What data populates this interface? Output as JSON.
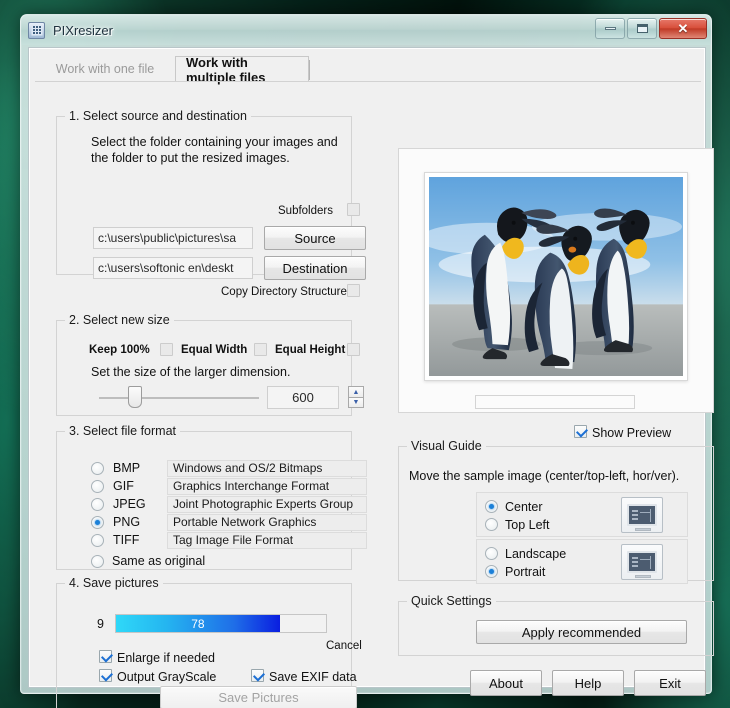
{
  "window": {
    "title": "PIXresizer",
    "icon": "app-grid-icon",
    "controls": {
      "minimize": "Minimize",
      "maximize": "Maximize",
      "close": "Close",
      "close_glyph": "✕"
    }
  },
  "tabs": [
    {
      "label": "Work with one file",
      "active": false
    },
    {
      "label": "Work with multiple files",
      "active": true
    }
  ],
  "section1": {
    "legend": "1. Select source and destination",
    "help_line1": "Select the folder containing your images and",
    "help_line2": "the folder to put the resized images.",
    "subfolders_label": "Subfolders",
    "subfolders_checked": false,
    "source_value": "c:\\users\\public\\pictures\\sa",
    "source_button": "Source",
    "destination_value": "c:\\users\\softonic en\\deskt",
    "destination_button": "Destination",
    "copy_dir_label": "Copy Directory Structure",
    "copy_dir_checked": false
  },
  "section2": {
    "legend": "2. Select new size",
    "keep_label": "Keep 100%",
    "keep_checked": false,
    "equal_width_label": "Equal Width",
    "equal_width_checked": false,
    "equal_height_label": "Equal Height",
    "equal_height_checked": false,
    "instruction": "Set the size of the larger dimension.",
    "size_value": "600",
    "slider_percent": 19,
    "spin_up": "▲",
    "spin_down": "▼"
  },
  "section3": {
    "legend": "3. Select file format",
    "formats": [
      {
        "name": "BMP",
        "desc": "Windows and OS/2 Bitmaps",
        "selected": false
      },
      {
        "name": "GIF",
        "desc": "Graphics Interchange Format",
        "selected": false
      },
      {
        "name": "JPEG",
        "desc": "Joint Photographic Experts Group",
        "selected": false
      },
      {
        "name": "PNG",
        "desc": "Portable Network Graphics",
        "selected": true
      },
      {
        "name": "TIFF",
        "desc": "Tag Image File Format",
        "selected": false
      }
    ],
    "same_as_original": "Same as original",
    "same_as_original_selected": false
  },
  "section4": {
    "legend": "4. Save pictures",
    "counter": "9",
    "progress_value": "78",
    "progress_percent": 78,
    "cancel_label": "Cancel",
    "enlarge_label": "Enlarge if needed",
    "enlarge_checked": true,
    "grayscale_label": "Output GrayScale",
    "grayscale_checked": true,
    "exif_label": "Save EXIF data",
    "exif_checked": true,
    "save_button": "Save Pictures",
    "save_button_disabled": true
  },
  "preview": {
    "show_preview_label": "Show Preview",
    "show_preview_checked": true,
    "image_description": "three king penguins on a beach"
  },
  "visual_guide": {
    "legend": "Visual Guide",
    "instruction": "Move the sample image (center/top-left, hor/ver).",
    "position_options": [
      {
        "label": "Center",
        "selected": true
      },
      {
        "label": "Top Left",
        "selected": false
      }
    ],
    "orientation_options": [
      {
        "label": "Landscape",
        "selected": false
      },
      {
        "label": "Portrait",
        "selected": true
      }
    ]
  },
  "quick_settings": {
    "legend": "Quick Settings",
    "apply_button": "Apply recommended"
  },
  "footer_buttons": [
    {
      "label": "About"
    },
    {
      "label": "Help"
    },
    {
      "label": "Exit"
    }
  ],
  "colors": {
    "accent_blue": "#1b80d8",
    "progress_start": "#2fd8f8",
    "progress_end": "#0a1ee0",
    "close_red": "#d8503c"
  }
}
